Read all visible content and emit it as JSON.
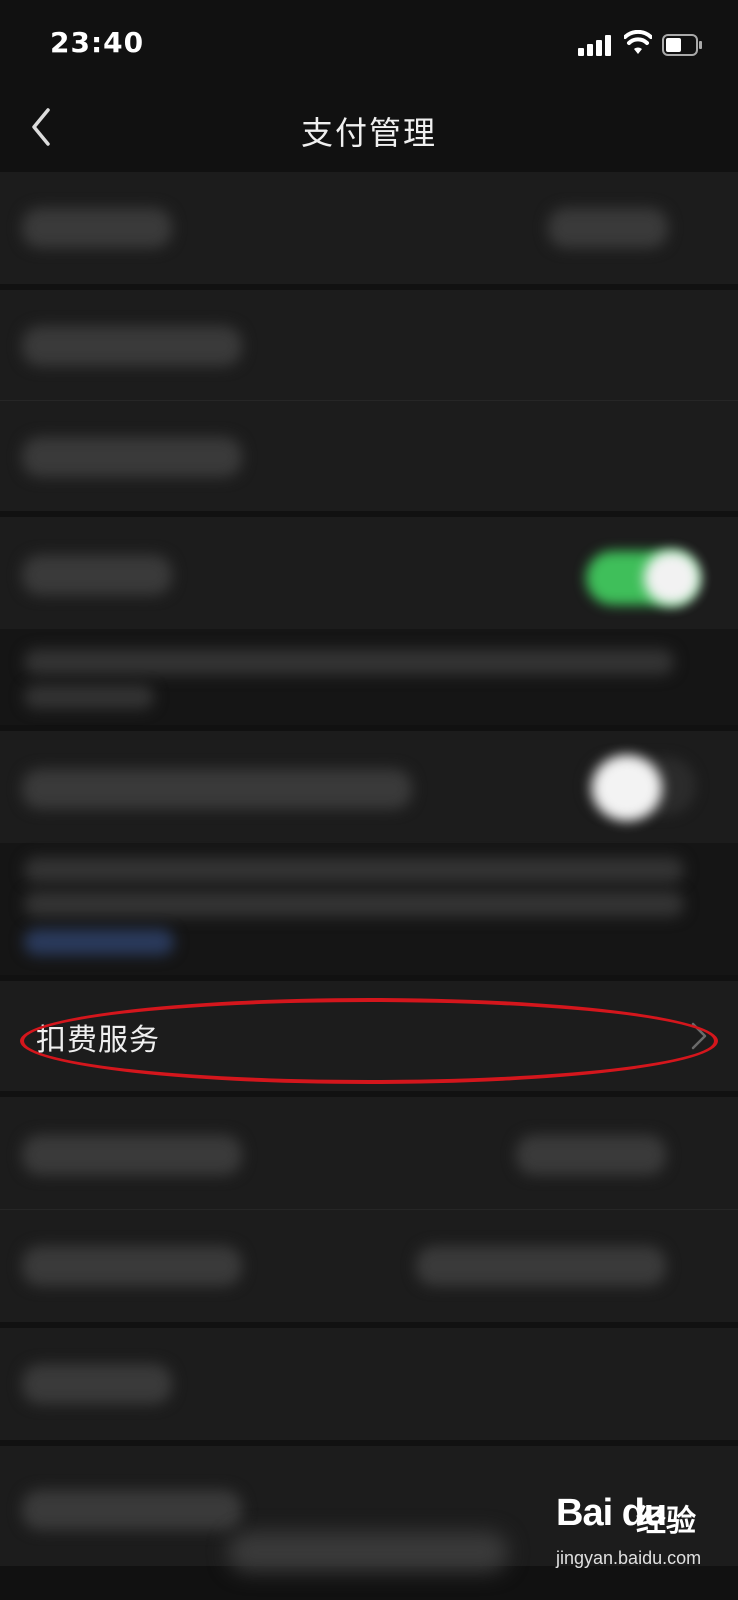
{
  "status_bar": {
    "time": "23:40",
    "icons": [
      "signal-icon",
      "wifi-icon",
      "battery-icon"
    ]
  },
  "nav": {
    "title": "支付管理",
    "back_icon": "chevron-left-icon"
  },
  "list": {
    "deduction_service_label": "扣费服务",
    "deduction_chevron_icon": "chevron-right-icon"
  },
  "annotation": {
    "highlight_color": "#d4161c"
  },
  "watermark": {
    "logo": "Bai du",
    "brand_suffix": "经验",
    "url": "jingyan.baidu.com"
  },
  "colors": {
    "toggle_on": "#3fbf5a",
    "background": "#111111",
    "cell": "#1c1c1c"
  }
}
